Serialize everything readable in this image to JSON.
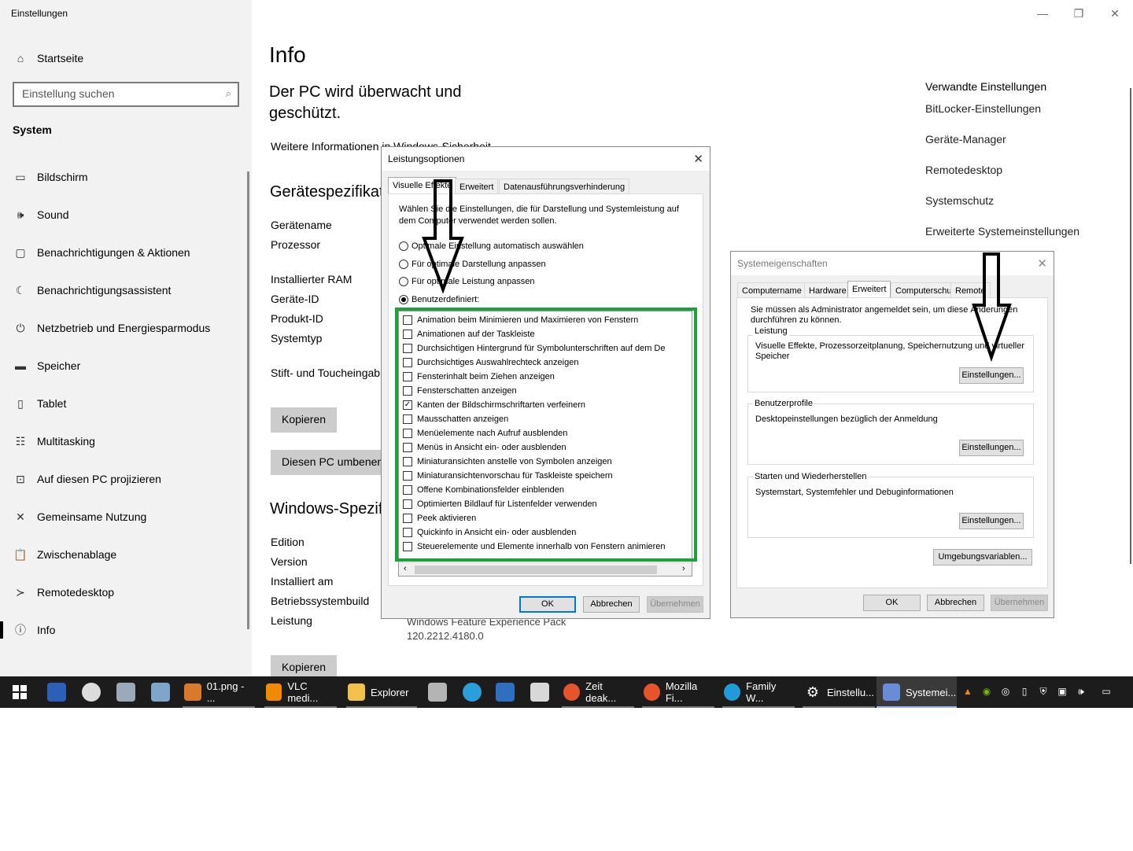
{
  "window": {
    "title": "Einstellungen",
    "minimize": "—",
    "restore": "❐",
    "close": "✕"
  },
  "sidebar": {
    "home_label": "Startseite",
    "search_placeholder": "Einstellung suchen",
    "section": "System",
    "items": [
      {
        "label": "Bildschirm",
        "icon": "monitor-icon",
        "glyph": "▭"
      },
      {
        "label": "Sound",
        "icon": "speaker-icon",
        "glyph": "🕪"
      },
      {
        "label": "Benachrichtigungen & Aktionen",
        "icon": "notification-icon",
        "glyph": "▢"
      },
      {
        "label": "Benachrichtigungsassistent",
        "icon": "moon-icon",
        "glyph": "☾"
      },
      {
        "label": "Netzbetrieb und Energiesparmodus",
        "icon": "power-icon",
        "glyph": "⏻"
      },
      {
        "label": "Speicher",
        "icon": "storage-icon",
        "glyph": "▬"
      },
      {
        "label": "Tablet",
        "icon": "tablet-icon",
        "glyph": "▯"
      },
      {
        "label": "Multitasking",
        "icon": "multitasking-icon",
        "glyph": "☷"
      },
      {
        "label": "Auf diesen PC projizieren",
        "icon": "project-icon",
        "glyph": "⊡"
      },
      {
        "label": "Gemeinsame Nutzung",
        "icon": "share-icon",
        "glyph": "✕"
      },
      {
        "label": "Zwischenablage",
        "icon": "clipboard-icon",
        "glyph": "📋"
      },
      {
        "label": "Remotedesktop",
        "icon": "remote-icon",
        "glyph": "≻"
      },
      {
        "label": "Info",
        "icon": "info-icon",
        "glyph": "ⓘ"
      }
    ]
  },
  "main": {
    "title": "Info",
    "subtitle": "Der PC wird überwacht und geschützt.",
    "more_info": "Weitere Informationen in Windows-Sicherheit",
    "device_specs_heading": "Gerätespezifikat",
    "device_specs": [
      "Gerätename",
      "Prozessor",
      "Installierter RAM",
      "Geräte-ID",
      "Produkt-ID",
      "Systemtyp",
      "Stift- und Toucheingab"
    ],
    "copy_button": "Kopieren",
    "rename_button": "Diesen PC umbenen",
    "windows_specs_heading": "Windows-Spezif",
    "windows_specs": [
      "Edition",
      "Version",
      "Installiert am",
      "Betriebssystembuild",
      "Leistung"
    ],
    "feature_pack": "Windows Feature Experience Pack",
    "feature_version": "120.2212.4180.0",
    "copy_button2": "Kopieren"
  },
  "related": {
    "title": "Verwandte Einstellungen",
    "links": [
      "BitLocker-Einstellungen",
      "Geräte-Manager",
      "Remotedesktop",
      "Systemschutz",
      "Erweiterte Systemeinstellungen"
    ]
  },
  "perf_dialog": {
    "title": "Leistungsoptionen",
    "tabs": [
      "Visuelle Effekte",
      "Erweitert",
      "Datenausführungsverhinderung"
    ],
    "intro": "Wählen Sie die Einstellungen, die für Darstellung und Systemleistung auf dem Computer verwendet werden sollen.",
    "radios": [
      {
        "label": "Optimale Einstellung automatisch auswählen",
        "selected": false
      },
      {
        "label": "Für optimale Darstellung anpassen",
        "selected": false
      },
      {
        "label": "Für optimale Leistung anpassen",
        "selected": false
      },
      {
        "label": "Benutzerdefiniert:",
        "selected": true
      }
    ],
    "checkboxes": [
      {
        "label": "Animation beim Minimieren und Maximieren von Fenstern",
        "checked": false
      },
      {
        "label": "Animationen auf der Taskleiste",
        "checked": false
      },
      {
        "label": "Durchsichtigen Hintergrund für Symbolunterschriften auf dem De",
        "checked": false
      },
      {
        "label": "Durchsichtiges Auswahlrechteck anzeigen",
        "checked": false
      },
      {
        "label": "Fensterinhalt beim Ziehen anzeigen",
        "checked": false
      },
      {
        "label": "Fensterschatten anzeigen",
        "checked": false
      },
      {
        "label": "Kanten der Bildschirmschriftarten verfeinern",
        "checked": true
      },
      {
        "label": "Mausschatten anzeigen",
        "checked": false
      },
      {
        "label": "Menüelemente nach Aufruf ausblenden",
        "checked": false
      },
      {
        "label": "Menüs in Ansicht ein- oder ausblenden",
        "checked": false
      },
      {
        "label": "Miniaturansichten anstelle von Symbolen anzeigen",
        "checked": false
      },
      {
        "label": "Miniaturansichtenvorschau für Taskleiste speichern",
        "checked": false
      },
      {
        "label": "Offene Kombinationsfelder einblenden",
        "checked": false
      },
      {
        "label": "Optimierten Bildlauf für Listenfelder verwenden",
        "checked": false
      },
      {
        "label": "Peek aktivieren",
        "checked": false
      },
      {
        "label": "Quickinfo in Ansicht ein- oder ausblenden",
        "checked": false
      },
      {
        "label": "Steuerelemente und Elemente innerhalb von Fenstern animieren",
        "checked": false
      }
    ],
    "ok": "OK",
    "cancel": "Abbrechen",
    "apply": "Übernehmen",
    "highlight_color": "#1aa33a"
  },
  "sys_dialog": {
    "title": "Systemeigenschaften",
    "tabs": [
      "Computername",
      "Hardware",
      "Erweitert",
      "Computerschutz",
      "Remote"
    ],
    "admin_note": "Sie müssen als Administrator angemeldet sein, um diese Änderungen durchführen zu können.",
    "perf_group": "Leistung",
    "perf_desc": "Visuelle Effekte, Prozessorzeitplanung, Speichernutzung und virtueller Speicher",
    "profiles_group": "Benutzerprofile",
    "profiles_desc": "Desktopeinstellungen bezüglich der Anmeldung",
    "startup_group": "Starten und Wiederherstellen",
    "startup_desc": "Systemstart, Systemfehler und Debuginformationen",
    "settings_button": "Einstellungen...",
    "env_button": "Umgebungsvariablen...",
    "ok": "OK",
    "cancel": "Abbrechen",
    "apply": "Übernehmen"
  },
  "taskbar": {
    "apps": [
      {
        "label": "01.png - ...",
        "icon": "paint-icon",
        "color": "#d97a2b"
      },
      {
        "label": "VLC medi...",
        "icon": "vlc-icon",
        "color": "#f08a00"
      },
      {
        "label": "Explorer",
        "icon": "folder-icon",
        "color": "#f2c14b"
      },
      {
        "label": "Zeit deak...",
        "icon": "firefox-icon",
        "color": "#e8542a"
      },
      {
        "label": "Mozilla Fi...",
        "icon": "firefox-icon",
        "color": "#e8542a"
      },
      {
        "label": "Family W...",
        "icon": "edge-icon",
        "color": "#1f9bd8"
      },
      {
        "label": "Einstellu...",
        "icon": "gear-icon",
        "color": "#ffffff"
      },
      {
        "label": "Systemei...",
        "icon": "system-properties-icon",
        "color": "#6a8bd6"
      }
    ]
  }
}
